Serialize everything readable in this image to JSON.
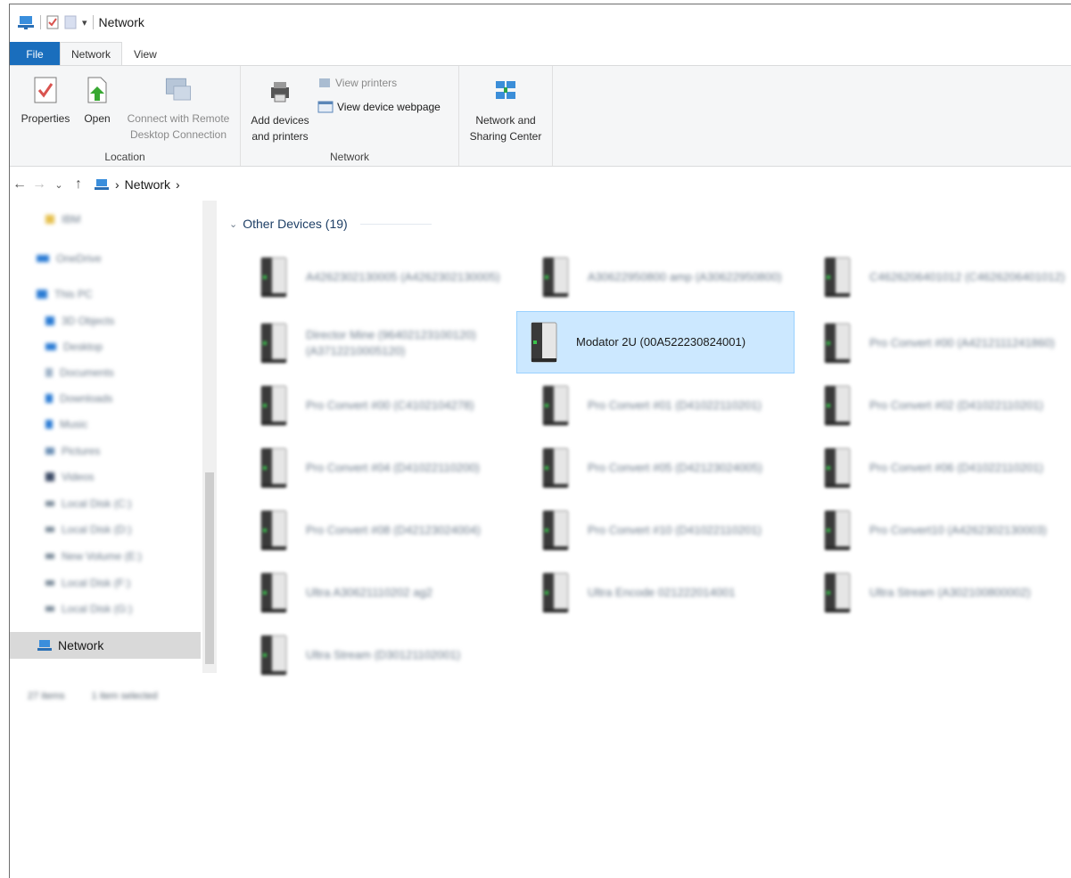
{
  "window": {
    "title": "Network"
  },
  "ribbon": {
    "tabs": [
      "File",
      "Network",
      "View"
    ],
    "location": {
      "label": "Location",
      "buttons": [
        "Properties",
        "Open",
        "Connect with Remote Desktop Connection"
      ]
    },
    "network": {
      "label": "Network",
      "add_devices": "Add devices and printers",
      "view_printers": "View printers",
      "view_webpage": "View device webpage"
    },
    "sharing": {
      "label": "Network and Sharing Center"
    }
  },
  "address": {
    "crumbs": [
      "Network"
    ]
  },
  "sidebar": {
    "items": [
      "IBM",
      "OneDrive",
      "This PC",
      "3D Objects",
      "Desktop",
      "Documents",
      "Downloads",
      "Music",
      "Pictures",
      "Videos",
      "Local Disk (C:)",
      "Local Disk (D:)",
      "New Volume (E:)",
      "Local Disk (F:)",
      "Local Disk (G:)"
    ],
    "network": "Network"
  },
  "status": {
    "count": "27 items",
    "selection": "1 item selected"
  },
  "content": {
    "group": "Other Devices (19)",
    "devices": [
      "A4262302130005 (A4262302130005)",
      "A30622950800 amp (A30622950800)",
      "C4626206401012 (C4626206401012)",
      "Director Mine (96402123100120) (A3712210005120)",
      "Modator 2U (00A522230824001)",
      "Pro Convert #00 (A4212111241860)",
      "Pro Convert #00 (C4102104278)",
      "Pro Convert #01 (D41022110201)",
      "Pro Convert #02 (D41022110201)",
      "Pro Convert #04 (D41022110200)",
      "Pro Convert #05 (D42123024005)",
      "Pro Convert #06 (D41022110201)",
      "Pro Convert #08 (D42123024004)",
      "Pro Convert #10 (D41022110201)",
      "Pro Convert10 (A4262302130003)",
      "Ultra A30621110202 ag2",
      "Ultra Encode 021222014001",
      "Ultra Stream (A302100800002)",
      "Ultra Stream (D30121102001)"
    ]
  },
  "colors": {
    "accent": "#1a6ebd",
    "selection": "#cce8ff",
    "selection_border": "#99d1ff"
  }
}
